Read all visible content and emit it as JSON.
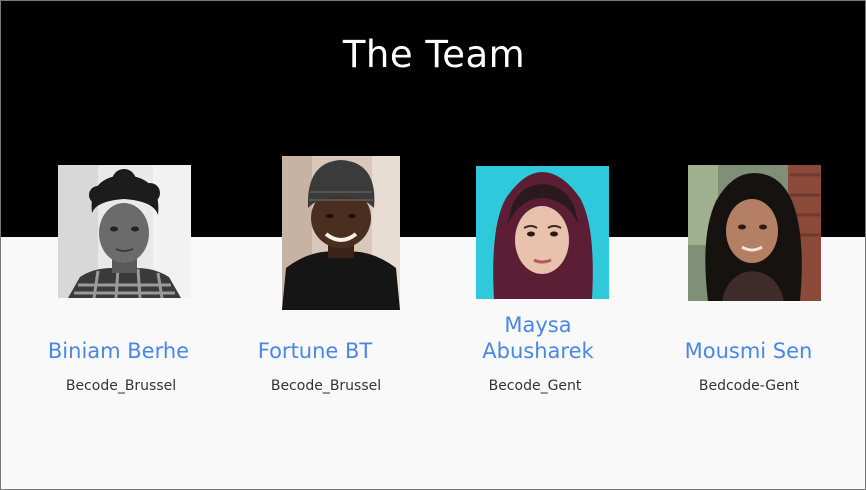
{
  "page": {
    "title": "The Team",
    "colors": {
      "header_background": "#000000",
      "title_text": "#ffffff",
      "body_background": "#f9f9f9",
      "name_text": "#4a86e8",
      "org_text": "#333333"
    }
  },
  "members": [
    {
      "name": "Biniam Berhe",
      "org": "Becode_Brussel",
      "photo_icon": "portrait-photo-icon"
    },
    {
      "name": "Fortune BT",
      "org": "Becode_Brussel",
      "photo_icon": "portrait-photo-icon"
    },
    {
      "name_line1": "Maysa",
      "name_line2": "Abusharek",
      "org": "Becode_Gent",
      "photo_icon": "portrait-photo-icon"
    },
    {
      "name": "Mousmi Sen",
      "org": "Bedcode-Gent",
      "photo_icon": "portrait-photo-icon"
    }
  ]
}
